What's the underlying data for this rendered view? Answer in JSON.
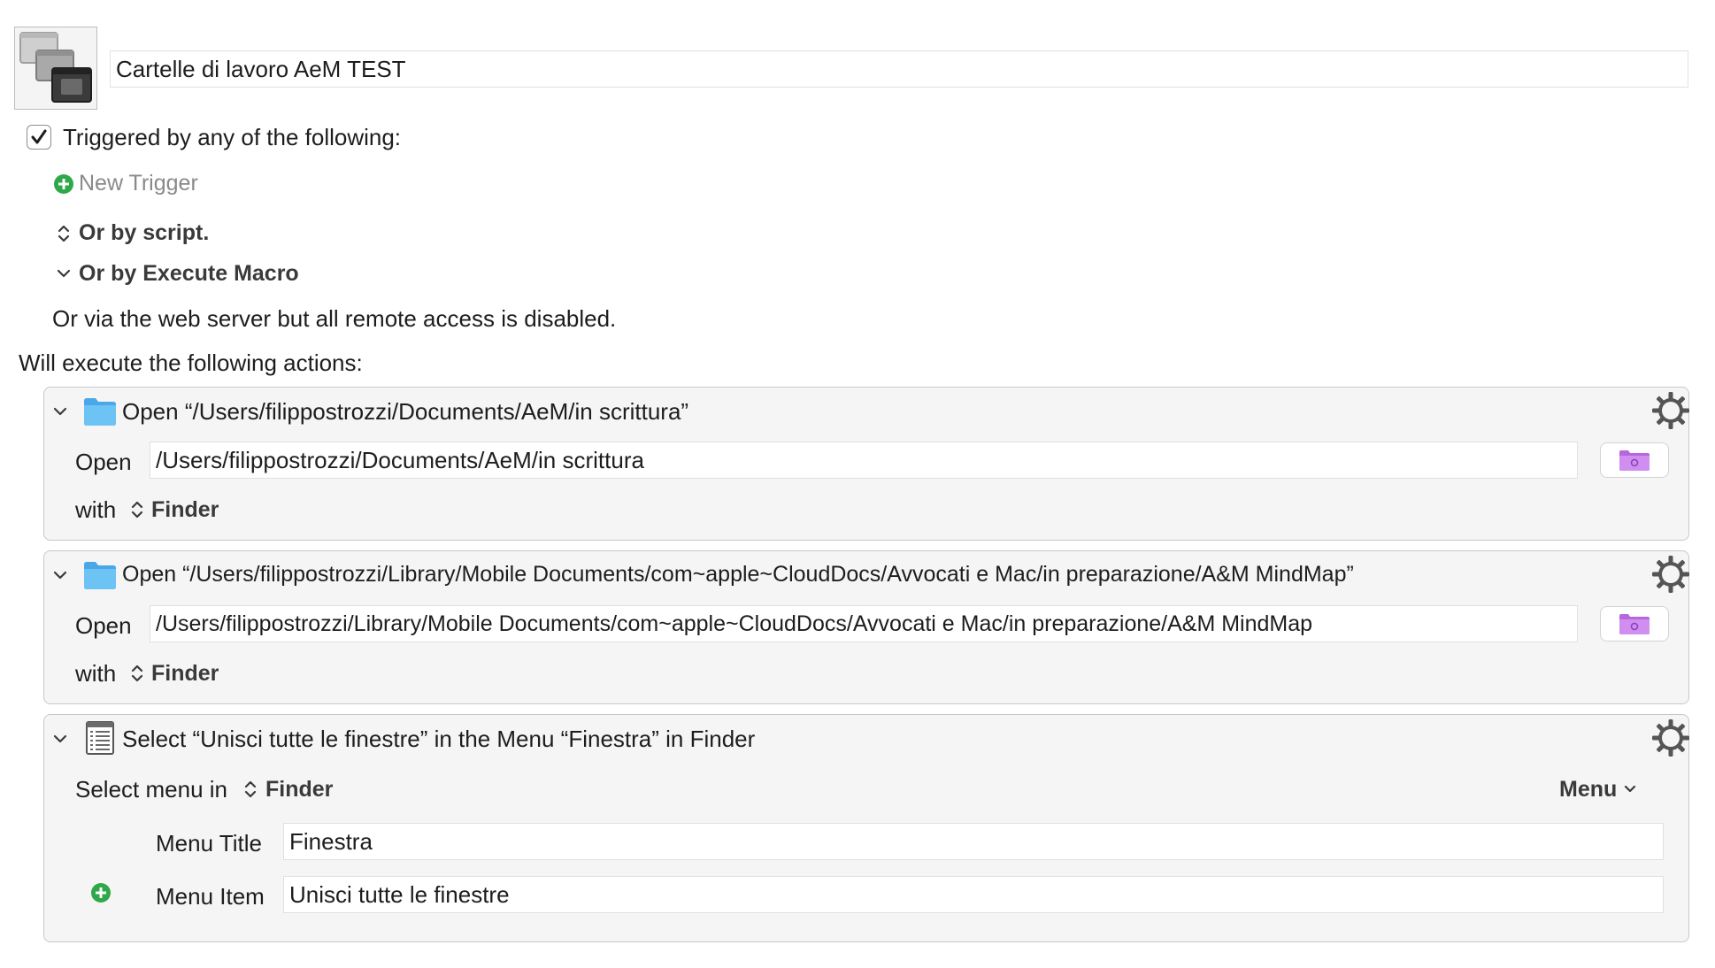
{
  "macro": {
    "name": "Cartelle di lavoro AeM TEST",
    "icon": "stacked-windows-icon"
  },
  "triggers": {
    "header": "Triggered by any of the following:",
    "enabled": true,
    "new_trigger_label": "New Trigger",
    "by_script_label": "Or by script.",
    "by_execute_macro_label": "Or by Execute Macro",
    "web_server_text": "Or via the web server but all remote access is disabled."
  },
  "actions": {
    "header": "Will execute the following actions:",
    "items": [
      {
        "title": "Open “/Users/filippostrozzi/Documents/AeM/in scrittura”",
        "open_label": "Open",
        "path": "/Users/filippostrozzi/Documents/AeM/in scrittura",
        "with_label": "with",
        "app": "Finder"
      },
      {
        "title": "Open “/Users/filippostrozzi/Library/Mobile Documents/com~apple~CloudDocs/Avvocati e Mac/in preparazione/A&M MindMap”",
        "open_label": "Open",
        "path": "/Users/filippostrozzi/Library/Mobile Documents/com~apple~CloudDocs/Avvocati e Mac/in preparazione/A&M MindMap",
        "with_label": "with",
        "app": "Finder"
      },
      {
        "title": "Select “Unisci tutte le finestre” in the Menu “Finestra” in Finder",
        "select_label": "Select menu in",
        "app": "Finder",
        "mode_label": "Menu",
        "menu_title_label": "Menu Title",
        "menu_title_value": "Finestra",
        "menu_item_label": "Menu Item",
        "menu_item_value": "Unisci tutte le finestre"
      }
    ]
  },
  "colors": {
    "add_green": "#2fa84a",
    "folder_blue": "#5cb8f0",
    "folder_purple": "#c77ee8"
  }
}
